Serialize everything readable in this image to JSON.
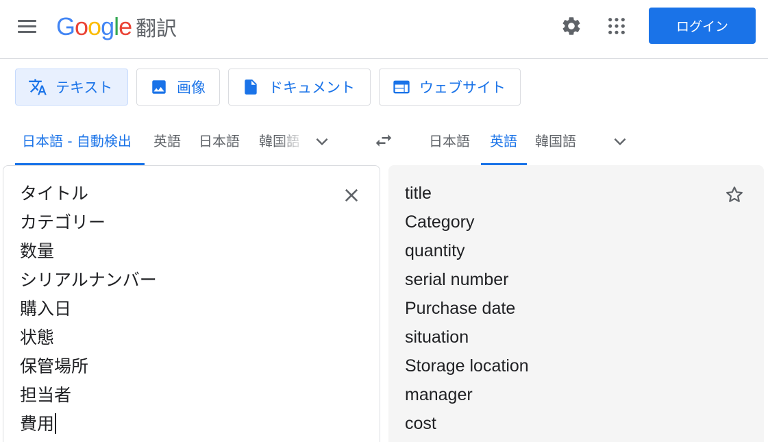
{
  "header": {
    "logo_text": "Google",
    "product_name": "翻訳",
    "login_label": "ログイン",
    "icons": [
      "menu-icon",
      "settings-gear-icon",
      "apps-grid-icon"
    ]
  },
  "colors": {
    "accent": "#1a73e8",
    "logo_blue": "#4285f4",
    "logo_red": "#ea4335",
    "logo_yellow": "#fbbc05",
    "logo_green": "#34a853",
    "target_bg": "#f5f5f5"
  },
  "mode_tabs": [
    {
      "label": "テキスト",
      "icon": "translate-icon",
      "active": true
    },
    {
      "label": "画像",
      "icon": "image-icon",
      "active": false
    },
    {
      "label": "ドキュメント",
      "icon": "document-icon",
      "active": false
    },
    {
      "label": "ウェブサイト",
      "icon": "website-icon",
      "active": false
    }
  ],
  "source_languages": [
    {
      "label": "日本語 - 自動検出",
      "active": true
    },
    {
      "label": "英語",
      "active": false
    },
    {
      "label": "日本語",
      "active": false
    },
    {
      "label": "韓国語",
      "active": false
    }
  ],
  "target_languages": [
    {
      "label": "日本語",
      "active": false
    },
    {
      "label": "英語",
      "active": true
    },
    {
      "label": "韓国語",
      "active": false
    }
  ],
  "source_text": [
    "タイトル",
    "カテゴリー",
    "数量",
    "シリアルナンバー",
    "購入日",
    "状態",
    "保管場所",
    "担当者",
    "費用"
  ],
  "translated_text": [
    "title",
    "Category",
    "quantity",
    "serial number",
    "Purchase date",
    "situation",
    "Storage location",
    "manager",
    "cost"
  ]
}
